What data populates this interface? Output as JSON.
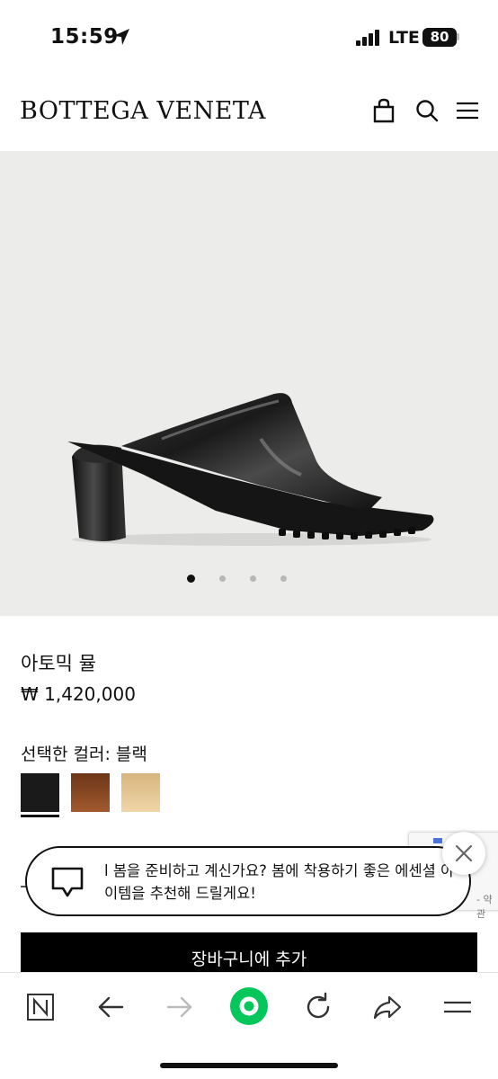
{
  "status_bar": {
    "time": "15:59",
    "network": "LTE",
    "battery": "80"
  },
  "header": {
    "brand": "BOTTEGA VENETA",
    "icons": [
      "bag-icon",
      "search-icon",
      "menu-icon"
    ]
  },
  "gallery": {
    "image": "black patent leather heeled mule sandal",
    "image_count": 4,
    "active_index": 0,
    "background": "#ecedeb"
  },
  "product": {
    "name": "아토믹 뮬",
    "price": "₩ 1,420,000",
    "selected_color_label": "선택한 컬러: 블랙",
    "swatches": [
      {
        "name": "black",
        "color": "#1a1a1a",
        "selected": true
      },
      {
        "name": "brown",
        "color": "#8a4a25",
        "selected": false
      },
      {
        "name": "beige",
        "color": "#e3c592",
        "selected": false
      }
    ]
  },
  "recaptcha": {
    "privacy_text": "- 약관"
  },
  "chat_bubble": {
    "message": "l 봄을 준비하고 계신가요? 봄에 착용하기 좋은 에센셜 아이템을 추천해 드릴게요!"
  },
  "cart": {
    "add_label": "장바구니에 추가"
  },
  "browser_toolbar": {
    "items": [
      "naver-n-icon",
      "back-arrow-icon",
      "forward-arrow-icon",
      "green-home-icon",
      "reload-icon",
      "share-icon",
      "menu-icon"
    ],
    "accent": "#03c75a"
  }
}
